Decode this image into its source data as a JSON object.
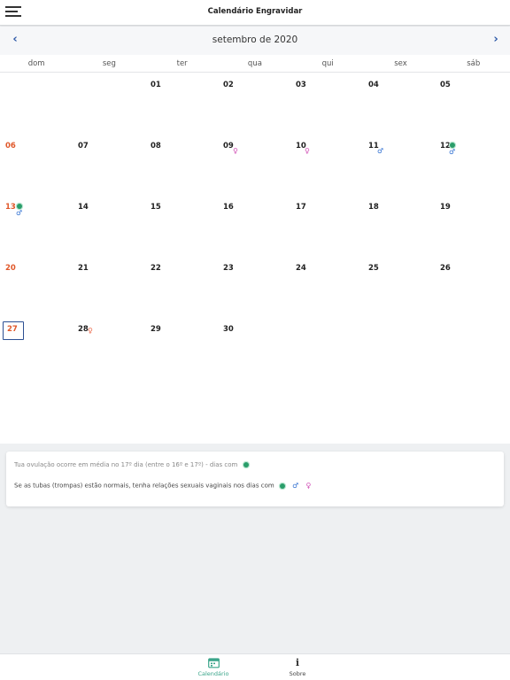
{
  "header": {
    "title": "Calendário Engravidar"
  },
  "calendar": {
    "month_title": "setembro de 2020",
    "weekdays": [
      "dom",
      "seg",
      "ter",
      "qua",
      "qui",
      "sex",
      "sáb"
    ],
    "days": [
      "01",
      "02",
      "03",
      "04",
      "05",
      "06",
      "07",
      "08",
      "09",
      "10",
      "11",
      "12",
      "13",
      "14",
      "15",
      "16",
      "17",
      "18",
      "19",
      "20",
      "21",
      "22",
      "23",
      "24",
      "25",
      "26",
      "27",
      "28",
      "29",
      "30"
    ],
    "today": "27",
    "symbols": {
      "male": "♂",
      "female": "♀",
      "female_orange": "♀"
    }
  },
  "info": {
    "line1": "Tua ovulação ocorre em média no 17º dia (entre o 16º e 17º) - dias com",
    "line2": "Se as tubas (trompas) estão normais, tenha relações sexuais vaginais nos dias com"
  },
  "colors": {
    "accent": "#3aa58a",
    "sunday": "#e0582a",
    "ovulation": "#2a9d6a",
    "male": "#2f6fd1",
    "female": "#d14fb6",
    "today_border": "#2c4f92"
  },
  "tabs": [
    {
      "label": "Calendário",
      "icon": "calendar-icon"
    },
    {
      "label": "Sobre",
      "icon": "info-icon"
    }
  ]
}
